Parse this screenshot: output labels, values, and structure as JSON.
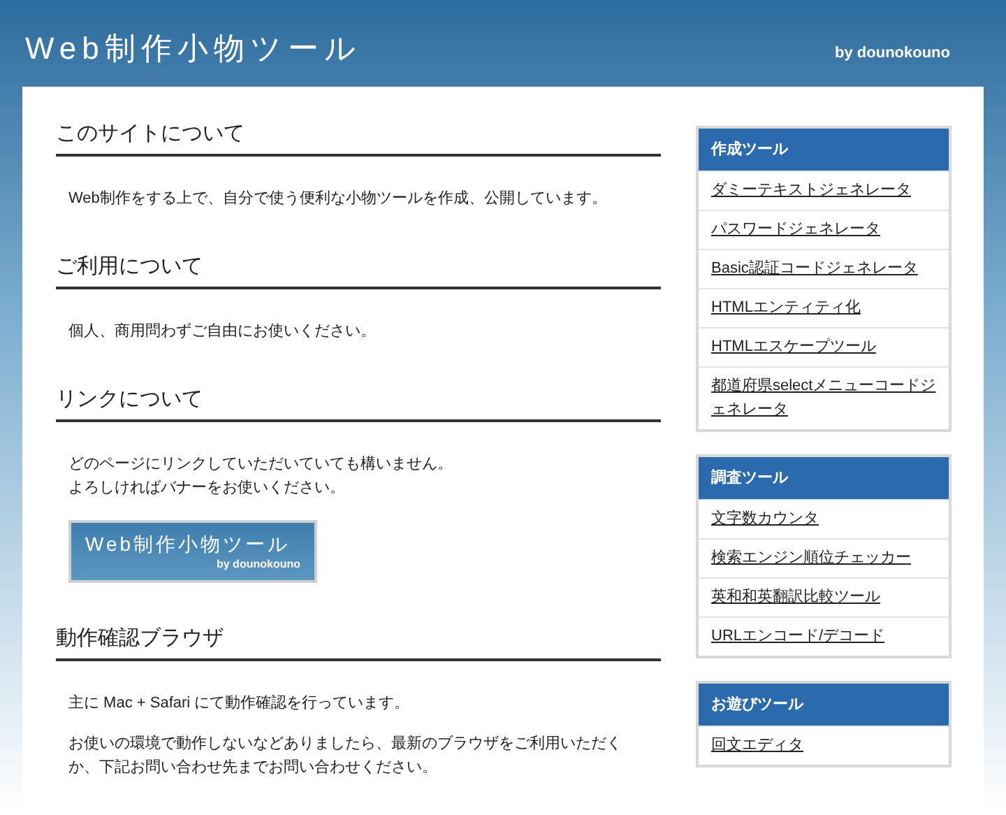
{
  "header": {
    "title": "Web制作小物ツール",
    "byline": "by dounokouno"
  },
  "sections": [
    {
      "heading": "このサイトについて",
      "paragraphs": [
        [
          "Web制作をする上で、自分で使う便利な小物ツールを作成、公開しています。"
        ]
      ]
    },
    {
      "heading": "ご利用について",
      "paragraphs": [
        [
          "個人、商用問わずご自由にお使いください。"
        ]
      ]
    },
    {
      "heading": "リンクについて",
      "paragraphs": [
        [
          "どのページにリンクしていただいていても構いません。",
          "よろしければバナーをお使いください。"
        ]
      ],
      "banner": {
        "title": "Web制作小物ツール",
        "byline": "by dounokouno"
      }
    },
    {
      "heading": "動作確認ブラウザ",
      "paragraphs": [
        [
          "主に Mac + Safari にて動作確認を行っています。"
        ],
        [
          "お使いの環境で動作しないなどありましたら、最新のブラウザをご利用いただくか、下記お問い合わせ先までお問い合わせください。"
        ]
      ]
    }
  ],
  "sidebar": [
    {
      "title": "作成ツール",
      "links": [
        "ダミーテキストジェネレータ",
        "パスワードジェネレータ",
        "Basic認証コードジェネレータ",
        "HTMLエンティティ化",
        "HTMLエスケープツール",
        "都道府県selectメニューコードジェネレータ"
      ]
    },
    {
      "title": "調査ツール",
      "links": [
        "文字数カウンタ",
        "検索エンジン順位チェッカー",
        "英和和英翻訳比較ツール",
        "URLエンコード/デコード"
      ]
    },
    {
      "title": "お遊びツール",
      "links": [
        "回文エディタ"
      ]
    }
  ]
}
